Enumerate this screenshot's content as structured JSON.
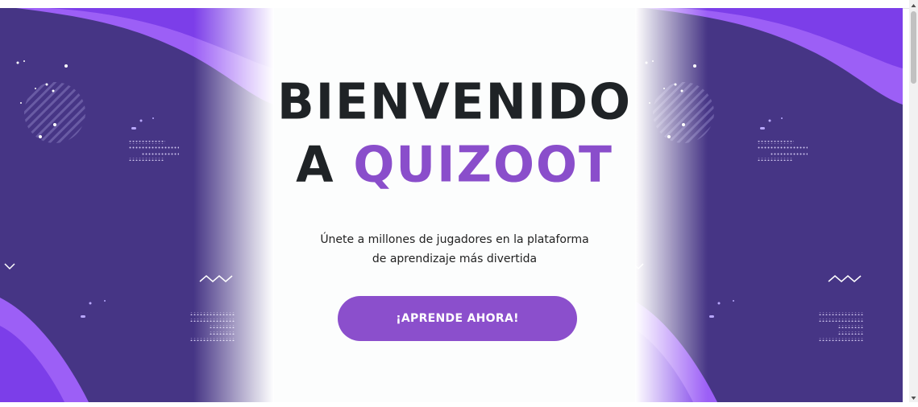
{
  "hero": {
    "title_line1": "BIENVENIDO",
    "title_line2_prefix": "A ",
    "title_line2_brand": "QUIZOOT",
    "subtitle": "Únete a millones de jugadores en la plataforma de aprendizaje más divertida",
    "cta_label": "¡APRENDE AHORA!"
  },
  "colors": {
    "banner_bg": "#463585",
    "accent": "#8b4fcc",
    "heading": "#1f2326",
    "wave_light": "#9a5cf5",
    "wave_bright": "#7a3dea"
  },
  "icons": {
    "banner_decoration": "wave-dots-pattern",
    "scroll_up": "triangle-up-icon",
    "scroll_down": "triangle-down-icon"
  }
}
